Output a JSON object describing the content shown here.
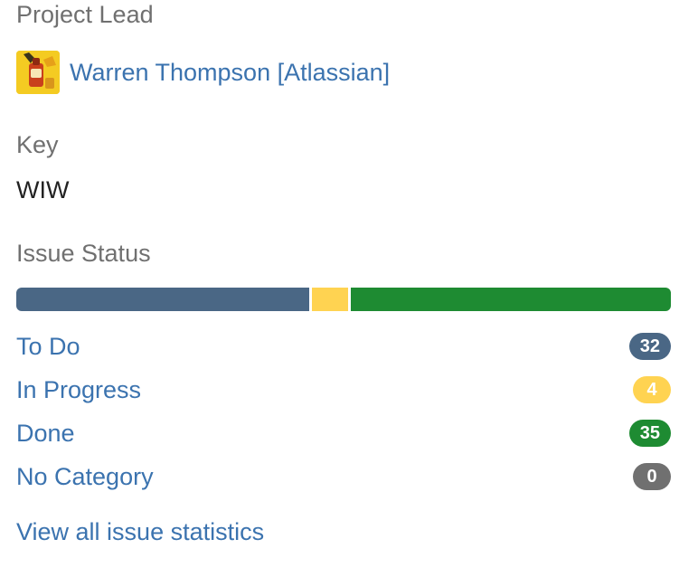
{
  "project_lead": {
    "label": "Project Lead",
    "name": "Warren Thompson [Atlassian]",
    "avatar_icon": "user-avatar-icon"
  },
  "key": {
    "label": "Key",
    "value": "WIW"
  },
  "issue_status": {
    "label": "Issue Status",
    "statuses": [
      {
        "label": "To Do",
        "count": "32",
        "color": "#4a6785",
        "text_color": "#ffffff"
      },
      {
        "label": "In Progress",
        "count": "4",
        "color": "#ffd351",
        "text_color": "#ffffff"
      },
      {
        "label": "Done",
        "count": "35",
        "color": "#1e8b32",
        "text_color": "#ffffff"
      },
      {
        "label": "No Category",
        "count": "0",
        "color": "#707070",
        "text_color": "#ffffff"
      }
    ]
  },
  "footer": {
    "view_all_label": "View all issue statistics"
  },
  "colors": {
    "link": "#3b73af",
    "label": "#707070",
    "text": "#222222"
  }
}
